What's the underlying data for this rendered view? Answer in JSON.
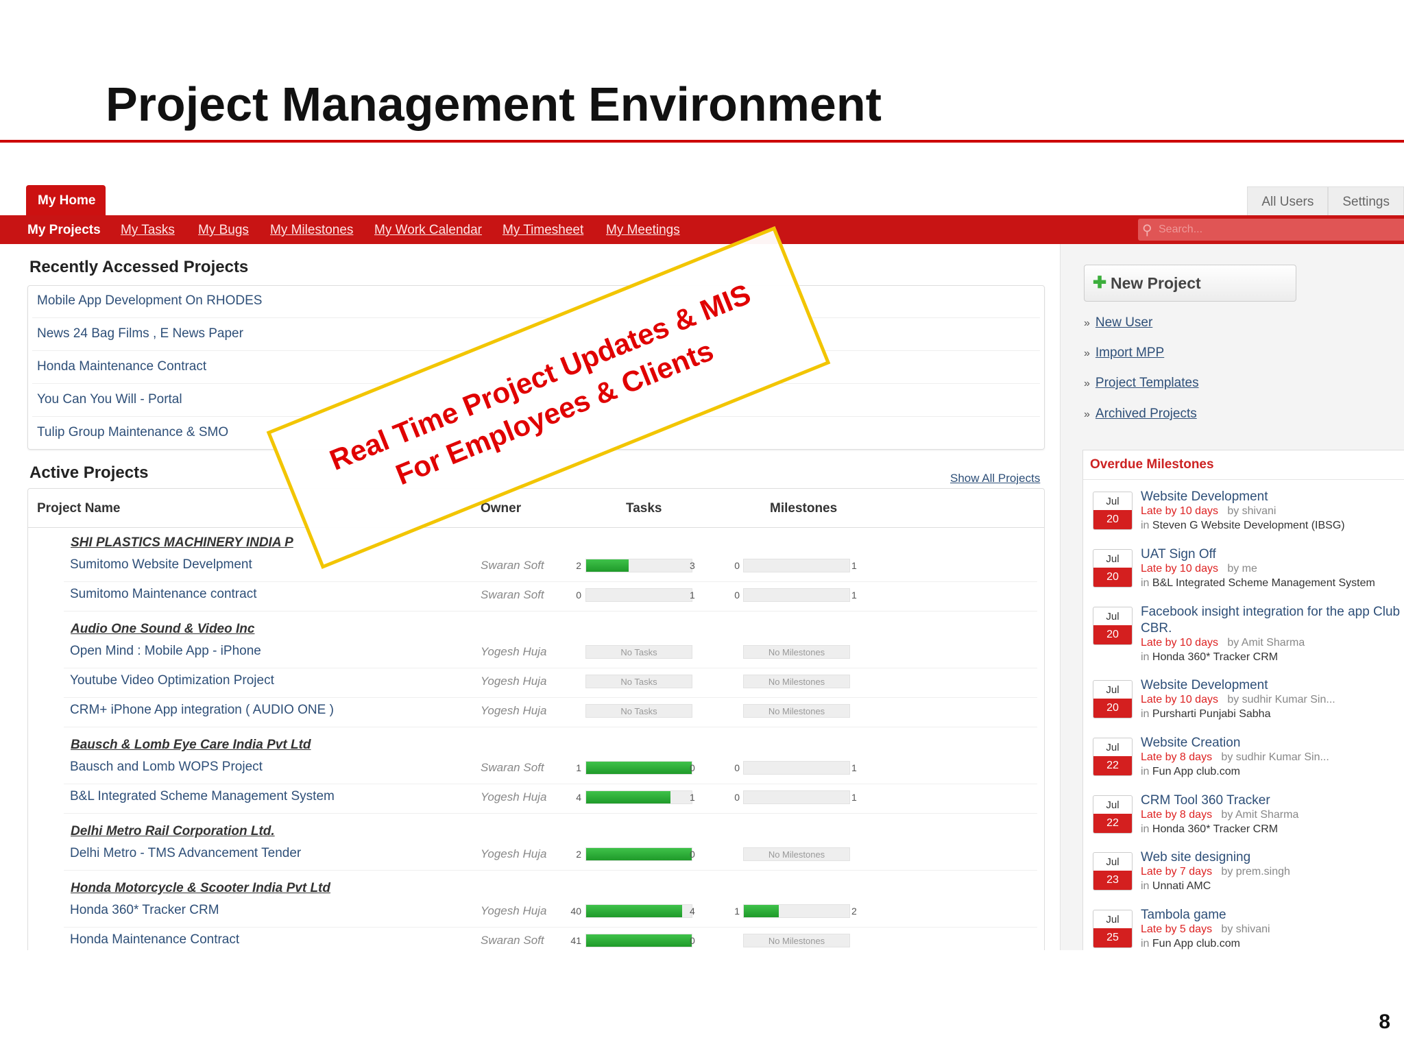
{
  "slide": {
    "title": "Project Management Environment",
    "page_number": "8"
  },
  "callout": {
    "line1": "Real Time Project Updates & MIS",
    "line2": "For Employees & Clients",
    "border_color": "#f2c500",
    "text_color": "#e00000"
  },
  "header": {
    "home_tab": "My Home",
    "right_tabs": [
      "All Users",
      "Settings"
    ],
    "nav": [
      "My Projects",
      "My Tasks",
      "My Bugs",
      "My Milestones",
      "My Work Calendar",
      "My Timesheet",
      "My Meetings"
    ],
    "search_placeholder": "Search...",
    "accent_color": "#c81414"
  },
  "recent": {
    "heading": "Recently Accessed Projects",
    "items": [
      "Mobile App Development On RHODES",
      "News 24 Bag Films , E News Paper",
      "Honda Maintenance Contract",
      "You Can You Will - Portal",
      "Tulip Group Maintenance & SMO"
    ]
  },
  "active": {
    "heading": "Active Projects",
    "show_all": "Show All Projects",
    "columns": {
      "name": "Project Name",
      "owner": "Owner",
      "tasks": "Tasks",
      "milestones": "Milestones"
    },
    "no_tasks": "No Tasks",
    "no_milestones": "No Milestones",
    "groups": [
      {
        "company": "SHI PLASTICS MACHINERY INDIA P",
        "projects": [
          {
            "name": "Sumitomo Website Develpment",
            "owner": "Swaran Soft",
            "tasks_done": "2",
            "tasks_open": "3",
            "tasks_pct": 0.4,
            "ms_done": "0",
            "ms_open": "1",
            "ms_pct": 0
          },
          {
            "name": "Sumitomo Maintenance contract",
            "owner": "Swaran Soft",
            "tasks_done": "0",
            "tasks_open": "1",
            "tasks_pct": 0,
            "ms_done": "0",
            "ms_open": "1",
            "ms_pct": 0
          }
        ]
      },
      {
        "company": "Audio One Sound & Video Inc",
        "projects": [
          {
            "name": "Open Mind : Mobile App - iPhone",
            "owner": "Yogesh Huja",
            "no_tasks": true,
            "no_ms": true
          },
          {
            "name": "Youtube Video Optimization Project",
            "owner": "Yogesh Huja",
            "no_tasks": true,
            "no_ms": true
          },
          {
            "name": "CRM+ iPhone App integration ( AUDIO ONE )",
            "owner": "Yogesh Huja",
            "no_tasks": true,
            "no_ms": true
          }
        ]
      },
      {
        "company": "Bausch & Lomb Eye Care India Pvt Ltd",
        "projects": [
          {
            "name": "Bausch and Lomb WOPS Project",
            "owner": "Swaran Soft",
            "tasks_done": "1",
            "tasks_open": "0",
            "tasks_pct": 1,
            "ms_done": "0",
            "ms_open": "1",
            "ms_pct": 0
          },
          {
            "name": "B&L Integrated Scheme Management System",
            "owner": "Yogesh Huja",
            "tasks_done": "4",
            "tasks_open": "1",
            "tasks_pct": 0.8,
            "ms_done": "0",
            "ms_open": "1",
            "ms_pct": 0
          }
        ]
      },
      {
        "company": "Delhi Metro Rail Corporation Ltd.",
        "projects": [
          {
            "name": "Delhi Metro - TMS Advancement Tender",
            "owner": "Yogesh Huja",
            "tasks_done": "2",
            "tasks_open": "0",
            "tasks_pct": 1,
            "no_ms": true
          }
        ]
      },
      {
        "company": "Honda Motorcycle & Scooter India Pvt Ltd",
        "projects": [
          {
            "name": "Honda 360* Tracker CRM",
            "owner": "Yogesh Huja",
            "tasks_done": "40",
            "tasks_open": "4",
            "tasks_pct": 0.91,
            "ms_done": "1",
            "ms_open": "2",
            "ms_pct": 0.33
          },
          {
            "name": "Honda Maintenance Contract",
            "owner": "Swaran Soft",
            "tasks_done": "41",
            "tasks_open": "0",
            "tasks_pct": 1,
            "no_ms": true
          }
        ]
      }
    ]
  },
  "sidebar": {
    "new_project": "New Project",
    "links": [
      "New User",
      "Import MPP",
      "Project Templates",
      "Archived Projects"
    ]
  },
  "overdue": {
    "title": "Overdue Milestones",
    "items": [
      {
        "month": "Jul",
        "day": "20",
        "name": "Website Development",
        "late": "Late by 10 days",
        "by": "by shivani",
        "in": "Steven G Website Development (IBSG)"
      },
      {
        "month": "Jul",
        "day": "20",
        "name": "UAT Sign Off",
        "late": "Late by 10 days",
        "by": "by me",
        "in": "B&L Integrated Scheme Management System"
      },
      {
        "month": "Jul",
        "day": "20",
        "name": "Facebook insight integration for the app Club CBR.",
        "late": "Late by 10 days",
        "by": "by Amit Sharma",
        "in": "Honda 360* Tracker CRM"
      },
      {
        "month": "Jul",
        "day": "20",
        "name": "Website Development",
        "late": "Late by 10 days",
        "by": "by sudhir Kumar Sin...",
        "in": "Pursharti Punjabi Sabha"
      },
      {
        "month": "Jul",
        "day": "22",
        "name": "Website Creation",
        "late": "Late by 8 days",
        "by": "by sudhir Kumar Sin...",
        "in": "Fun App club.com"
      },
      {
        "month": "Jul",
        "day": "22",
        "name": "CRM Tool 360 Tracker",
        "late": "Late by 8 days",
        "by": "by Amit Sharma",
        "in": "Honda 360* Tracker CRM"
      },
      {
        "month": "Jul",
        "day": "23",
        "name": "Web site designing",
        "late": "Late by 7 days",
        "by": "by prem.singh",
        "in": "Unnati AMC"
      },
      {
        "month": "Jul",
        "day": "25",
        "name": "Tambola game",
        "late": "Late by 5 days",
        "by": "by shivani",
        "in": "Fun App club.com"
      }
    ]
  }
}
